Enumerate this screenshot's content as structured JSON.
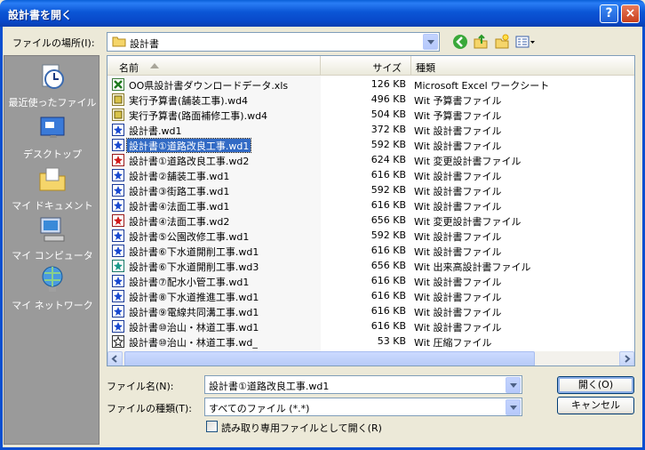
{
  "window": {
    "title": "設計書を開く",
    "help": "?",
    "close": "×"
  },
  "lookin": {
    "label": "ファイルの場所(I):",
    "value": "設計書"
  },
  "places": [
    {
      "label": "最近使ったファイル",
      "icon": "recent-clock-icon"
    },
    {
      "label": "デスクトップ",
      "icon": "desktop-icon"
    },
    {
      "label": "マイ ドキュメント",
      "icon": "my-documents-icon"
    },
    {
      "label": "マイ コンピュータ",
      "icon": "my-computer-icon"
    },
    {
      "label": "マイ ネットワーク",
      "icon": "my-network-icon"
    }
  ],
  "columns": {
    "name": "名前",
    "size": "サイズ",
    "type": "種類"
  },
  "files": [
    {
      "name": "OO県設計書ダウンロードデータ.xls",
      "size": "126 KB",
      "type": "Microsoft Excel ワークシート",
      "icon": "excel"
    },
    {
      "name": "実行予算書(舗装工事).wd4",
      "size": "496 KB",
      "type": "Wit 予算書ファイル",
      "icon": "budget"
    },
    {
      "name": "実行予算書(路面補修工事).wd4",
      "size": "504 KB",
      "type": "Wit 予算書ファイル",
      "icon": "budget"
    },
    {
      "name": "設計書.wd1",
      "size": "372 KB",
      "type": "Wit 設計書ファイル",
      "icon": "design"
    },
    {
      "name": "設計書①道路改良工事.wd1",
      "size": "592 KB",
      "type": "Wit 設計書ファイル",
      "icon": "design",
      "selected": true
    },
    {
      "name": "設計書①道路改良工事.wd2",
      "size": "624 KB",
      "type": "Wit 変更設計書ファイル",
      "icon": "change"
    },
    {
      "name": "設計書②舗装工事.wd1",
      "size": "616 KB",
      "type": "Wit 設計書ファイル",
      "icon": "design"
    },
    {
      "name": "設計書③街路工事.wd1",
      "size": "592 KB",
      "type": "Wit 設計書ファイル",
      "icon": "design"
    },
    {
      "name": "設計書④法面工事.wd1",
      "size": "616 KB",
      "type": "Wit 設計書ファイル",
      "icon": "design"
    },
    {
      "name": "設計書④法面工事.wd2",
      "size": "656 KB",
      "type": "Wit 変更設計書ファイル",
      "icon": "change"
    },
    {
      "name": "設計書⑤公園改修工事.wd1",
      "size": "592 KB",
      "type": "Wit 設計書ファイル",
      "icon": "design"
    },
    {
      "name": "設計書⑥下水道開削工事.wd1",
      "size": "616 KB",
      "type": "Wit 設計書ファイル",
      "icon": "design"
    },
    {
      "name": "設計書⑥下水道開削工事.wd3",
      "size": "656 KB",
      "type": "Wit 出来高設計書ファイル",
      "icon": "progress"
    },
    {
      "name": "設計書⑦配水小管工事.wd1",
      "size": "616 KB",
      "type": "Wit 設計書ファイル",
      "icon": "design"
    },
    {
      "name": "設計書⑧下水道推進工事.wd1",
      "size": "616 KB",
      "type": "Wit 設計書ファイル",
      "icon": "design"
    },
    {
      "name": "設計書⑨電線共同溝工事.wd1",
      "size": "616 KB",
      "type": "Wit 設計書ファイル",
      "icon": "design"
    },
    {
      "name": "設計書⑩治山・林道工事.wd1",
      "size": "616 KB",
      "type": "Wit 設計書ファイル",
      "icon": "design"
    },
    {
      "name": "設計書⑩治山・林道工事.wd_",
      "size": "53 KB",
      "type": "Wit 圧縮ファイル",
      "icon": "compressed"
    }
  ],
  "filename": {
    "label": "ファイル名(N):",
    "value": "設計書①道路改良工事.wd1"
  },
  "filetype": {
    "label": "ファイルの種類(T):",
    "value": "すべてのファイル (*.*)"
  },
  "readonly": {
    "label": "読み取り専用ファイルとして開く(R)"
  },
  "buttons": {
    "open": "開く(O)",
    "cancel": "キャンセル"
  },
  "colors": {
    "titlebar": "#0a56d6",
    "selection": "#316ac5",
    "dialog": "#ece9d8",
    "places": "#9a9a9a"
  }
}
